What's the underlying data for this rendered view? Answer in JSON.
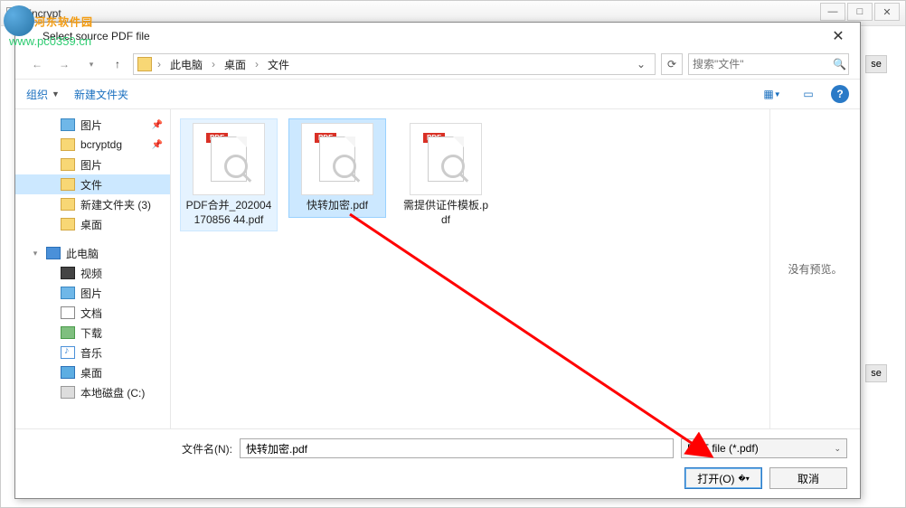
{
  "bg": {
    "title": "Encrypt",
    "se": "se"
  },
  "watermark": {
    "line1": "河东软件园",
    "line2": "www.pc0359.cn"
  },
  "dialog": {
    "title": "Select source PDF file",
    "breadcrumb": {
      "root": "此电脑",
      "p1": "桌面",
      "p2": "文件"
    },
    "search_placeholder": "搜索\"文件\"",
    "toolbar": {
      "organize": "组织",
      "newfolder": "新建文件夹"
    },
    "tree": [
      {
        "icon": "pic",
        "label": "图片",
        "pin": true,
        "indent": 1
      },
      {
        "icon": "folder",
        "label": "bcryptdg",
        "pin": true,
        "indent": 1
      },
      {
        "icon": "folder",
        "label": "图片",
        "indent": 1
      },
      {
        "icon": "folder",
        "label": "文件",
        "selected": true,
        "indent": 1
      },
      {
        "icon": "folder",
        "label": "新建文件夹 (3)",
        "indent": 1
      },
      {
        "icon": "folder",
        "label": "桌面",
        "indent": 1
      },
      {
        "label": "",
        "spacer": true
      },
      {
        "icon": "pc",
        "label": "此电脑",
        "expander": "▾",
        "indent": 0
      },
      {
        "icon": "vid",
        "label": "视频",
        "indent": 1
      },
      {
        "icon": "pic",
        "label": "图片",
        "indent": 1
      },
      {
        "icon": "doc",
        "label": "文档",
        "indent": 1
      },
      {
        "icon": "down",
        "label": "下载",
        "indent": 1
      },
      {
        "icon": "music",
        "label": "音乐",
        "indent": 1
      },
      {
        "icon": "desk",
        "label": "桌面",
        "indent": 1
      },
      {
        "icon": "disk",
        "label": "本地磁盘 (C:)",
        "indent": 1
      }
    ],
    "files": [
      {
        "name": "PDF合并_202004170856 44.pdf",
        "state": "hover"
      },
      {
        "name": "快转加密.pdf",
        "state": "selected"
      },
      {
        "name": "需提供证件模板.pdf",
        "state": ""
      }
    ],
    "preview_text": "没有预览。",
    "filename_label": "文件名(N):",
    "filename_value": "快转加密.pdf",
    "filetype": "PDF file (*.pdf)",
    "open_btn": "打开(O)",
    "cancel_btn": "取消"
  }
}
